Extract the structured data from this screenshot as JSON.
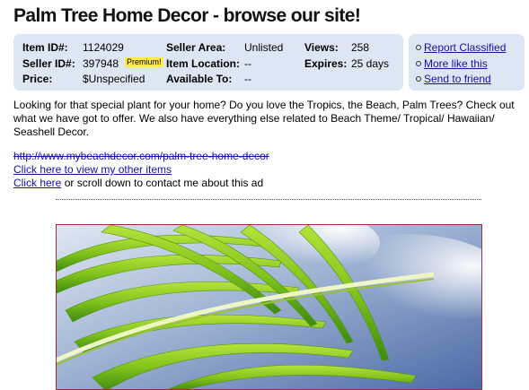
{
  "page": {
    "title": "Palm Tree Home Decor - browse our site!"
  },
  "info": {
    "item_id_label": "Item ID#:",
    "item_id_value": "1124029",
    "seller_id_label": "Seller ID#:",
    "seller_id_value": "397948",
    "premium_badge": "Premium!",
    "price_label": "Price:",
    "price_value": "$Unspecified",
    "seller_area_label": "Seller Area:",
    "seller_area_value": "Unlisted",
    "item_location_label": "Item Location:",
    "item_location_value": "--",
    "available_to_label": "Available To:",
    "available_to_value": "--",
    "views_label": "Views:",
    "views_value": "258",
    "expires_label": "Expires:",
    "expires_value": "25 days"
  },
  "actions": {
    "report": "Report Classified",
    "more": "More like this",
    "send": "Send to friend"
  },
  "description": "Looking for that special plant for your home? Do you love the Tropics, the Beach, Palm Trees? Check out what we have got to offer. We also have everything else related to Beach Theme/ Tropical/ Hawaiian/ Seashell Decor.",
  "links": {
    "website": "http://www.mybeachdecor.com/palm-tree-home-decor",
    "other_items": "Click here to view my other items",
    "click_here": "Click here",
    "contact_rest": " or scroll down to contact me about this ad"
  },
  "colors": {
    "box_bg": "#dde7f3",
    "link": "#1a0dab",
    "premium_bg": "#ffe94d",
    "photo_border": "#9b2c3a",
    "leaf": "#8ccf22",
    "sky": "#6f8fbf"
  },
  "icons": {
    "bullet": "circle-bullet-icon",
    "photo": "palm-leaf-photo"
  }
}
